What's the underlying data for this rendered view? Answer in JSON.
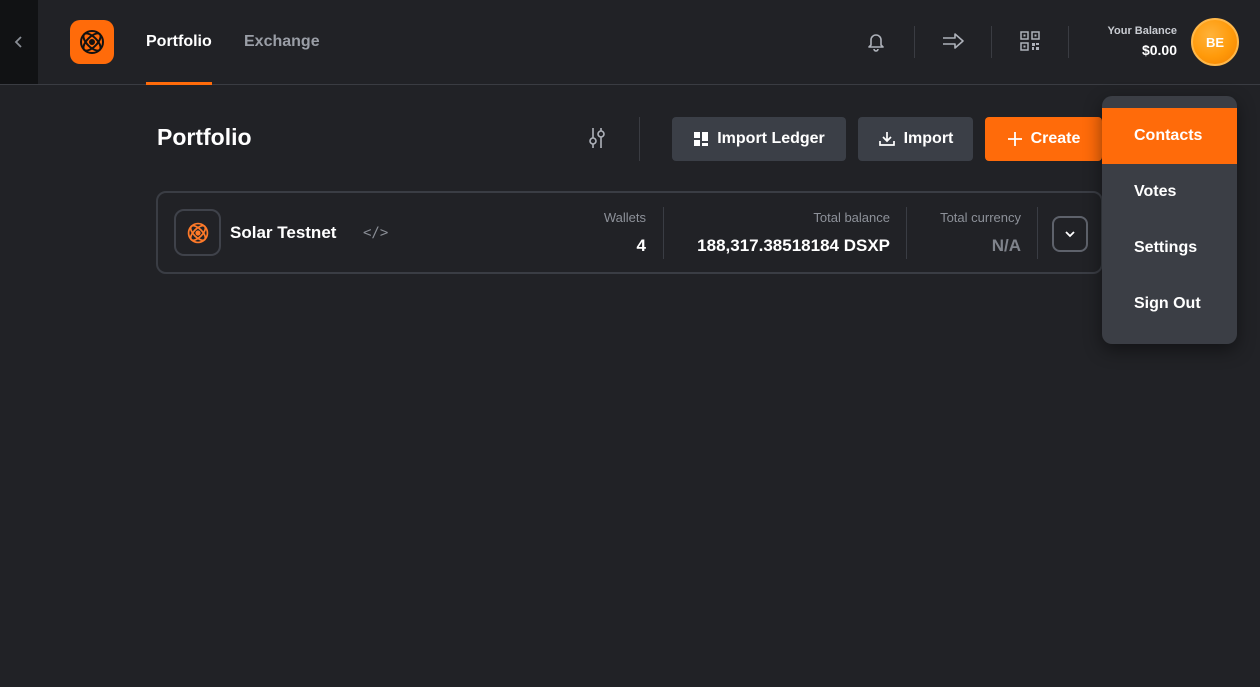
{
  "nav": {
    "tabs": [
      {
        "label": "Portfolio",
        "active": true
      },
      {
        "label": "Exchange",
        "active": false
      }
    ]
  },
  "header": {
    "balance_label": "Your Balance",
    "balance_value": "$0.00",
    "avatar_initials": "BE",
    "icons": [
      "back-chevron-icon",
      "bell-icon",
      "send-arrow-icon",
      "qr-code-icon"
    ]
  },
  "portfolio": {
    "title": "Portfolio",
    "buttons": {
      "import_ledger": "Import Ledger",
      "import": "Import",
      "create": "Create"
    }
  },
  "network_card": {
    "name": "Solar Testnet",
    "wallets_label": "Wallets",
    "wallets_value": "4",
    "total_balance_label": "Total balance",
    "total_balance_value": "188,317.38518184 DSXP",
    "total_currency_label": "Total currency",
    "total_currency_value": "N/A"
  },
  "menu": {
    "items": [
      {
        "label": "Contacts",
        "active": true
      },
      {
        "label": "Votes",
        "active": false
      },
      {
        "label": "Settings",
        "active": false
      },
      {
        "label": "Sign Out",
        "active": false
      }
    ]
  },
  "colors": {
    "accent": "#ff6b0a",
    "background": "#212226",
    "panel": "#3b3e45"
  }
}
